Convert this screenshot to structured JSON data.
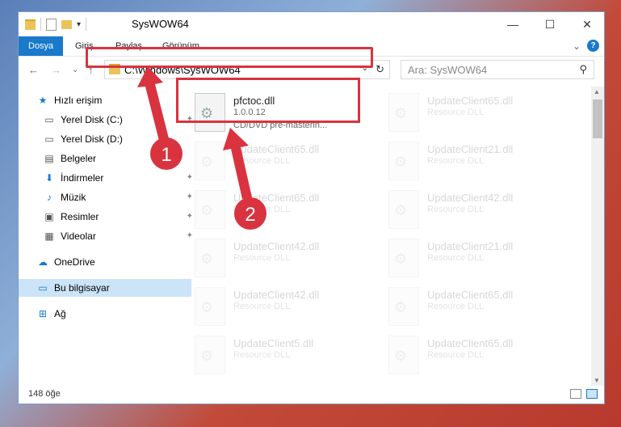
{
  "window": {
    "title": "SysWOW64",
    "minimize_icon": "—",
    "maximize_icon": "☐",
    "close_icon": "✕"
  },
  "ribbon": {
    "tabs": [
      "Dosya",
      "Giriş",
      "Paylaş",
      "Görünüm"
    ],
    "expand_icon": "⌄",
    "help_label": "?"
  },
  "navigation": {
    "back_icon": "←",
    "forward_icon": "→",
    "recent_icon": "⌄",
    "up_icon": "↑",
    "address_path": "C:\\Windows\\SysWOW64",
    "address_drop_icon": "⌄",
    "refresh_icon": "↻",
    "search_placeholder": "Ara: SysWOW64",
    "search_icon": "⚲"
  },
  "sidebar": {
    "items": [
      {
        "label": "Hızlı erişim",
        "icon": "★",
        "pinned": false
      },
      {
        "label": "Yerel Disk (C:)",
        "icon": "▭",
        "pinned": true
      },
      {
        "label": "Yerel Disk (D:)",
        "icon": "▭",
        "pinned": false
      },
      {
        "label": "Belgeler",
        "icon": "▤",
        "pinned": false
      },
      {
        "label": "İndirmeler",
        "icon": "⬇",
        "pinned": true
      },
      {
        "label": "Müzik",
        "icon": "♪",
        "pinned": true
      },
      {
        "label": "Resimler",
        "icon": "▣",
        "pinned": true
      },
      {
        "label": "Videolar",
        "icon": "▦",
        "pinned": true
      },
      {
        "label": "OneDrive",
        "icon": "☁",
        "pinned": false
      },
      {
        "label": "Bu bilgisayar",
        "icon": "▭",
        "pinned": false
      },
      {
        "label": "Ağ",
        "icon": "⊞",
        "pinned": false
      }
    ],
    "pin_icon": "✦"
  },
  "files": {
    "highlighted": {
      "name": "pfctoc.dll",
      "version": "1.0.0.12",
      "description": "CD/DVD pre-masterin..."
    },
    "faded": [
      {
        "name": "UpdateClient65.dll",
        "type": "Resource DLL"
      },
      {
        "name": "UpdateClient65.dll",
        "type": "Resource DLL"
      },
      {
        "name": "UpdateClient21.dll",
        "type": "Resource DLL"
      },
      {
        "name": "UpdateClient65.dll",
        "type": "Resource DLL"
      },
      {
        "name": "UpdateClient42.dll",
        "type": "Resource DLL"
      },
      {
        "name": "UpdateClient42.dll",
        "type": "Resource DLL"
      },
      {
        "name": "UpdateClient21.dll",
        "type": "Resource DLL"
      },
      {
        "name": "UpdateClient42.dll",
        "type": "Resource DLL"
      },
      {
        "name": "UpdateClient65.dll",
        "type": "Resource DLL"
      },
      {
        "name": "UpdateClient5.dll",
        "type": "Resource DLL"
      },
      {
        "name": "UpdateClient65.dll",
        "type": "Resource DLL"
      }
    ],
    "file_icon": "⚙"
  },
  "status": {
    "count": "148 öğe"
  },
  "annotations": {
    "label1": "1",
    "label2": "2",
    "arrow_color": "#d9333f",
    "box_color": "#d9333f"
  },
  "colors": {
    "accent": "#1979ca",
    "selection": "#cce4f7",
    "folder": "#e8c45a"
  }
}
